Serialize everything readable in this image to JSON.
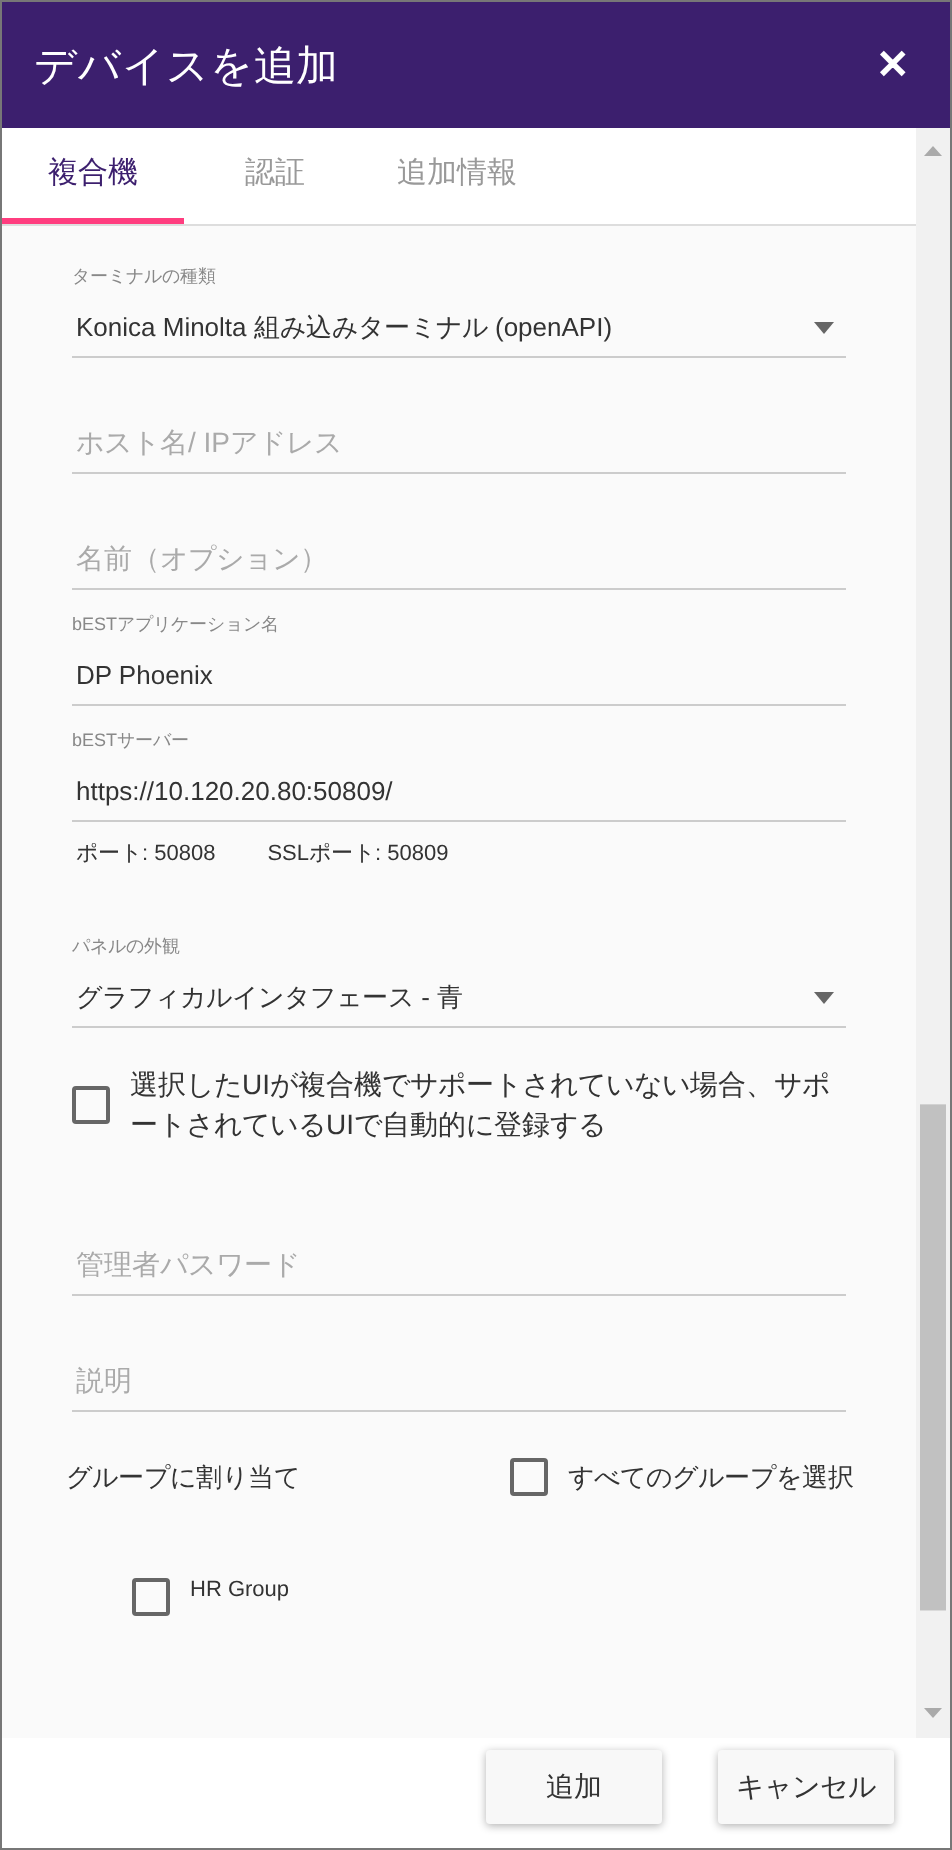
{
  "window": {
    "title": "デバイスを追加",
    "close": "✕"
  },
  "tabs": [
    {
      "label": "複合機",
      "selected": true
    },
    {
      "label": "認証",
      "selected": false
    },
    {
      "label": "追加情報",
      "selected": false
    }
  ],
  "fields": [
    {
      "kind": "select",
      "label": "ターミナルの種類",
      "value": "Konica Minolta 組み込みターミナル (openAPI)"
    },
    {
      "kind": "input",
      "placeholder": "ホスト名/ IPアドレス"
    },
    {
      "kind": "input",
      "placeholder": "名前（オプション）"
    },
    {
      "kind": "input",
      "label": "bESTアプリケーション名",
      "value": "DP Phoenix"
    },
    {
      "kind": "input",
      "label": "bESTサーバー",
      "value": "https://10.120.20.80:50809/"
    },
    {
      "kind": "ports",
      "items": [
        "ポート: 50808",
        "SSLポート: 50809"
      ]
    },
    {
      "kind": "select",
      "label": "パネルの外観",
      "value": "グラフィカルインタフェース - 青"
    },
    {
      "kind": "checkbox",
      "label": "選択したUIが複合機でサポートされていない場合、サポートされているUIで自動的に登録する",
      "checked": false
    },
    {
      "kind": "input",
      "placeholder": "管理者パスワード"
    },
    {
      "kind": "input",
      "placeholder": "説明"
    }
  ],
  "groups": {
    "label": "グループに割り当て",
    "select_all": {
      "label": "すべてのグループを選択",
      "checked": false
    },
    "items": [
      {
        "label": "HR Group",
        "checked": false
      }
    ]
  },
  "buttons": [
    "追加",
    "キャンセル"
  ]
}
